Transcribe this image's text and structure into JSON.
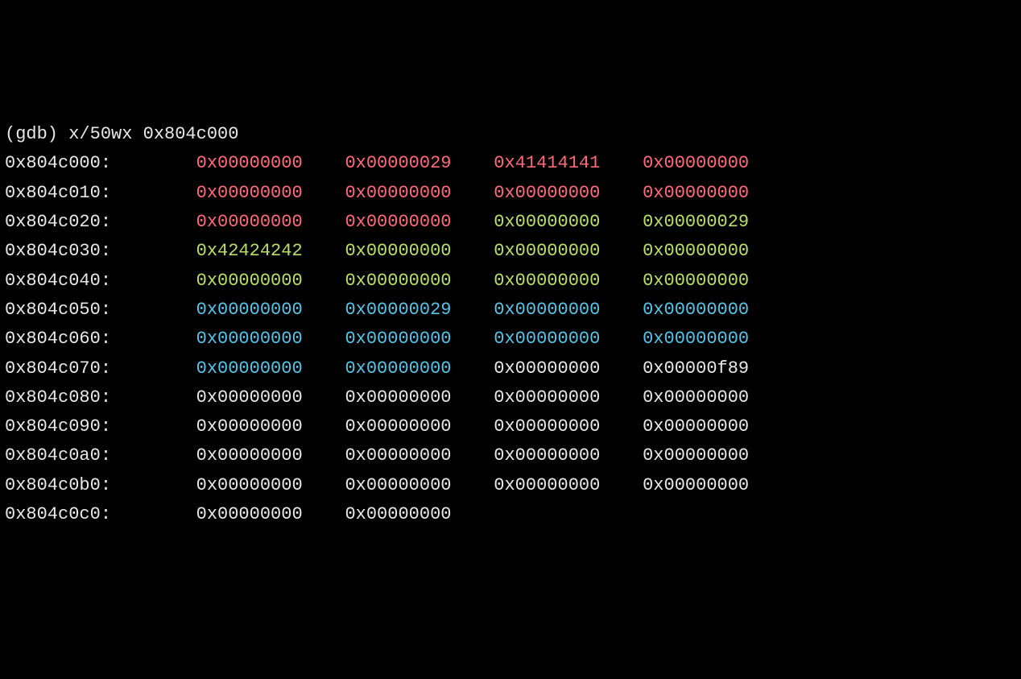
{
  "prompt": "(gdb) x/50wx 0x804c000",
  "colors": {
    "red": "#ff6b7a",
    "green": "#b8e068",
    "blue": "#58c4e8",
    "white": "#e8e8e8"
  },
  "rows": [
    {
      "addr": "0x804c000:",
      "words": [
        {
          "v": "0x00000000",
          "c": "red"
        },
        {
          "v": "0x00000029",
          "c": "red"
        },
        {
          "v": "0x41414141",
          "c": "red"
        },
        {
          "v": "0x00000000",
          "c": "red"
        }
      ]
    },
    {
      "addr": "0x804c010:",
      "words": [
        {
          "v": "0x00000000",
          "c": "red"
        },
        {
          "v": "0x00000000",
          "c": "red"
        },
        {
          "v": "0x00000000",
          "c": "red"
        },
        {
          "v": "0x00000000",
          "c": "red"
        }
      ]
    },
    {
      "addr": "0x804c020:",
      "words": [
        {
          "v": "0x00000000",
          "c": "red"
        },
        {
          "v": "0x00000000",
          "c": "red"
        },
        {
          "v": "0x00000000",
          "c": "green"
        },
        {
          "v": "0x00000029",
          "c": "green"
        }
      ]
    },
    {
      "addr": "0x804c030:",
      "words": [
        {
          "v": "0x42424242",
          "c": "green"
        },
        {
          "v": "0x00000000",
          "c": "green"
        },
        {
          "v": "0x00000000",
          "c": "green"
        },
        {
          "v": "0x00000000",
          "c": "green"
        }
      ]
    },
    {
      "addr": "0x804c040:",
      "words": [
        {
          "v": "0x00000000",
          "c": "green"
        },
        {
          "v": "0x00000000",
          "c": "green"
        },
        {
          "v": "0x00000000",
          "c": "green"
        },
        {
          "v": "0x00000000",
          "c": "green"
        }
      ]
    },
    {
      "addr": "0x804c050:",
      "words": [
        {
          "v": "0x00000000",
          "c": "blue"
        },
        {
          "v": "0x00000029",
          "c": "blue"
        },
        {
          "v": "0x00000000",
          "c": "blue"
        },
        {
          "v": "0x00000000",
          "c": "blue"
        }
      ]
    },
    {
      "addr": "0x804c060:",
      "words": [
        {
          "v": "0x00000000",
          "c": "blue"
        },
        {
          "v": "0x00000000",
          "c": "blue"
        },
        {
          "v": "0x00000000",
          "c": "blue"
        },
        {
          "v": "0x00000000",
          "c": "blue"
        }
      ]
    },
    {
      "addr": "0x804c070:",
      "words": [
        {
          "v": "0x00000000",
          "c": "blue"
        },
        {
          "v": "0x00000000",
          "c": "blue"
        },
        {
          "v": "0x00000000",
          "c": "white"
        },
        {
          "v": "0x00000f89",
          "c": "white"
        }
      ]
    },
    {
      "addr": "0x804c080:",
      "words": [
        {
          "v": "0x00000000",
          "c": "white"
        },
        {
          "v": "0x00000000",
          "c": "white"
        },
        {
          "v": "0x00000000",
          "c": "white"
        },
        {
          "v": "0x00000000",
          "c": "white"
        }
      ]
    },
    {
      "addr": "0x804c090:",
      "words": [
        {
          "v": "0x00000000",
          "c": "white"
        },
        {
          "v": "0x00000000",
          "c": "white"
        },
        {
          "v": "0x00000000",
          "c": "white"
        },
        {
          "v": "0x00000000",
          "c": "white"
        }
      ]
    },
    {
      "addr": "0x804c0a0:",
      "words": [
        {
          "v": "0x00000000",
          "c": "white"
        },
        {
          "v": "0x00000000",
          "c": "white"
        },
        {
          "v": "0x00000000",
          "c": "white"
        },
        {
          "v": "0x00000000",
          "c": "white"
        }
      ]
    },
    {
      "addr": "0x804c0b0:",
      "words": [
        {
          "v": "0x00000000",
          "c": "white"
        },
        {
          "v": "0x00000000",
          "c": "white"
        },
        {
          "v": "0x00000000",
          "c": "white"
        },
        {
          "v": "0x00000000",
          "c": "white"
        }
      ]
    },
    {
      "addr": "0x804c0c0:",
      "words": [
        {
          "v": "0x00000000",
          "c": "white"
        },
        {
          "v": "0x00000000",
          "c": "white"
        }
      ]
    }
  ]
}
